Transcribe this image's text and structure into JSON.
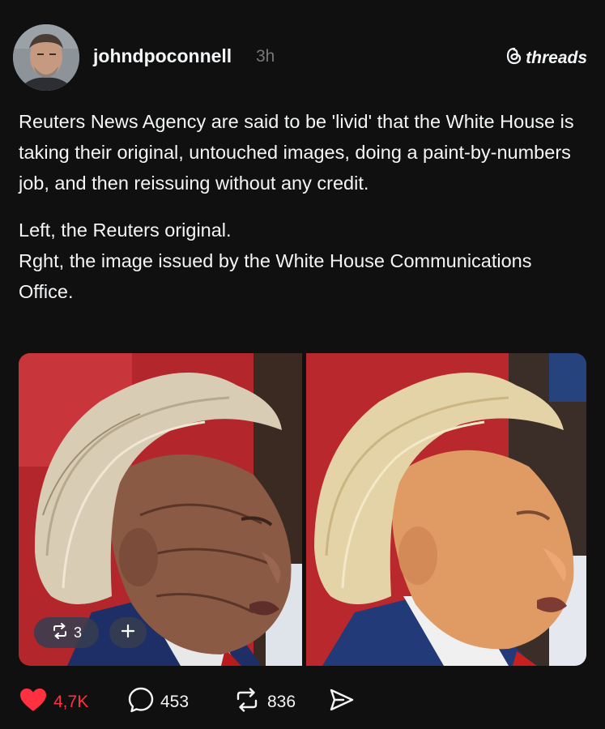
{
  "post": {
    "author": {
      "username": "johndpoconnell",
      "avatar_icon": "avatar"
    },
    "timestamp": "3h",
    "brand": {
      "name": "threads",
      "icon": "threads-logo-icon"
    },
    "text": {
      "paragraph1": "Reuters News Agency are said to be 'livid' that the White House is taking their original, untouched images, doing a paint-by-numbers job, and then reissuing without any credit.",
      "line2": "Left, the Reuters original.",
      "line3": "Rght, the image issued by the White House Communications Office."
    },
    "media": {
      "repost_count": "3",
      "add_icon": "plus-icon"
    },
    "actions": {
      "likes": "4,7K",
      "replies": "453",
      "reposts": "836"
    },
    "colors": {
      "background": "#101010",
      "text": "#f3f5f7",
      "muted": "#777777",
      "like": "#ff3040"
    }
  }
}
